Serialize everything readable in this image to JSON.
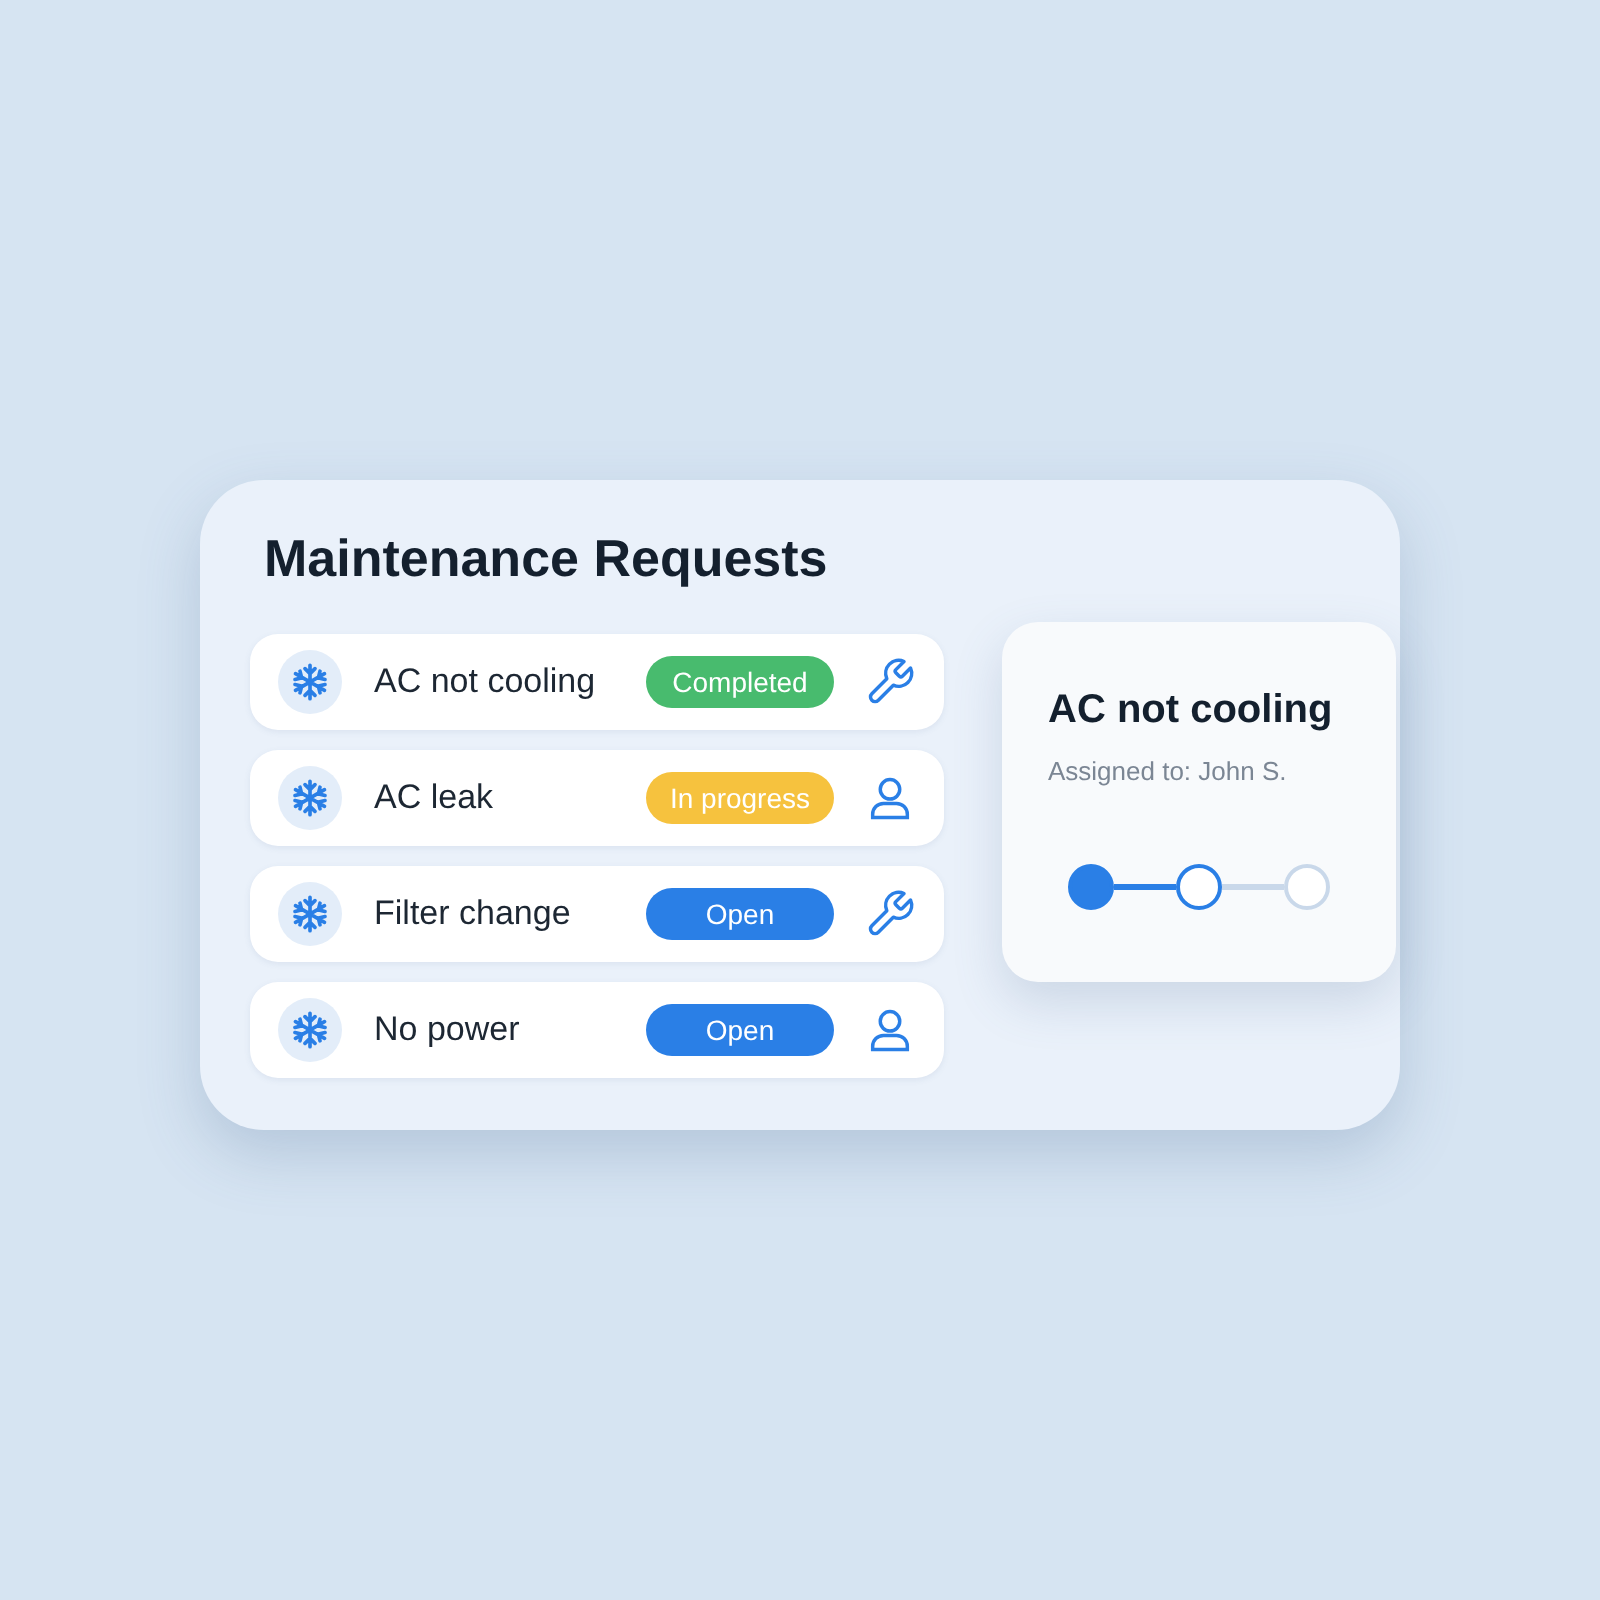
{
  "title": "Maintenance Requests",
  "requests": [
    {
      "name": "AC not cooling",
      "status": {
        "label": "Completed",
        "kind": "completed"
      },
      "action": {
        "kind": "wrench"
      }
    },
    {
      "name": "AC leak",
      "status": {
        "label": "In progress",
        "kind": "in_progress"
      },
      "action": {
        "kind": "person"
      }
    },
    {
      "name": "Filter change",
      "status": {
        "label": "Open",
        "kind": "open"
      },
      "action": {
        "kind": "wrench"
      }
    },
    {
      "name": "No power",
      "status": {
        "label": "Open",
        "kind": "open"
      },
      "action": {
        "kind": "person"
      }
    }
  ],
  "detail": {
    "title": "AC not cooling",
    "assigned": "Assigned to: John S.",
    "steps": [
      {
        "kind": "done"
      },
      {
        "kind": "current"
      },
      {
        "kind": "pending"
      }
    ]
  }
}
